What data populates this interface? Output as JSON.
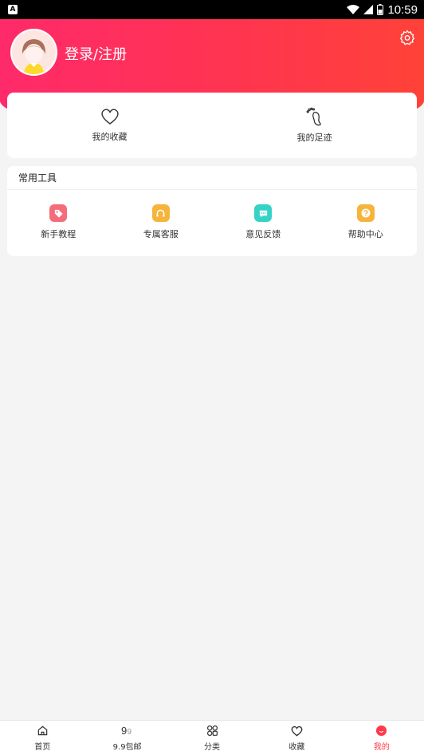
{
  "status_bar": {
    "time": "10:59",
    "app_icon_letter": "A"
  },
  "header": {
    "login_label": "登录/注册"
  },
  "quick_links": [
    {
      "label": "我的收藏",
      "icon": "heart-icon"
    },
    {
      "label": "我的足迹",
      "icon": "footprint-icon"
    }
  ],
  "tools": {
    "title": "常用工具",
    "items": [
      {
        "label": "新手教程",
        "icon": "tag-icon",
        "color": "#f66b7a"
      },
      {
        "label": "专属客服",
        "icon": "headset-icon",
        "color": "#f6b43a"
      },
      {
        "label": "意见反馈",
        "icon": "message-icon",
        "color": "#35d3c7"
      },
      {
        "label": "帮助中心",
        "icon": "question-icon",
        "color": "#f6b43a"
      }
    ]
  },
  "tab_bar": {
    "active_color": "#ff3a4a",
    "tabs": [
      {
        "label": "首页",
        "icon": "home-icon"
      },
      {
        "label": "9.9包邮",
        "icon": "nine-nine-icon"
      },
      {
        "label": "分类",
        "icon": "grid-icon"
      },
      {
        "label": "收藏",
        "icon": "heart-icon"
      },
      {
        "label": "我的",
        "icon": "profile-icon",
        "active": true
      }
    ]
  }
}
